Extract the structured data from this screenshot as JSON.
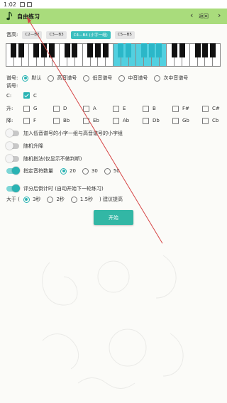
{
  "status_bar": {
    "time": "1:02"
  },
  "toolbar": {
    "title": "自由练习",
    "prev": "‹",
    "back": "返回",
    "next": "›"
  },
  "range": {
    "label": "音高:",
    "options": [
      {
        "label": "C2—B2",
        "active": false
      },
      {
        "label": "C3—B3",
        "active": false
      },
      {
        "label": "C4—B4 (小字一组)",
        "active": true
      },
      {
        "label": "C5—B5",
        "active": false
      }
    ]
  },
  "clef": {
    "label": "谱号:",
    "options": [
      {
        "label": "默认",
        "selected": true
      },
      {
        "label": "高音谱号",
        "selected": false
      },
      {
        "label": "低音谱号",
        "selected": false
      },
      {
        "label": "中音谱号",
        "selected": false
      },
      {
        "label": "次中音谱号",
        "selected": false
      }
    ]
  },
  "key": {
    "label": "调号:"
  },
  "natural": {
    "label": "C:",
    "items": [
      {
        "label": "C",
        "checked": true
      }
    ]
  },
  "sharp": {
    "label": "升:",
    "items": [
      "G",
      "D",
      "A",
      "E",
      "B",
      "F#",
      "C#"
    ]
  },
  "flat": {
    "label": "降:",
    "items": [
      "F",
      "Bb",
      "Eb",
      "Ab",
      "Db",
      "Gb",
      "Cb"
    ]
  },
  "switches": {
    "add_octaves": {
      "label": "加入低音谱号的小字一组与高音谱号的小字组",
      "on": false
    },
    "random_accidental": {
      "label": "随机升降",
      "on": false
    },
    "random_fingering": {
      "label": "随机指法(仅显示不做判断)",
      "on": false
    },
    "note_count": {
      "label": "指定音符数量",
      "on": true,
      "options": [
        "20",
        "30",
        "50"
      ],
      "selected": "20"
    },
    "countdown": {
      "label": "评分后倒计时 (自动开始下一轮练习)",
      "on": true
    }
  },
  "threshold": {
    "prefix": "大于 (",
    "options": [
      "3秒",
      "2秒",
      "1.5秒"
    ],
    "selected": "3秒",
    "suffix": ") 建议提高"
  },
  "start_button": {
    "label": "开始"
  },
  "colors": {
    "toolbar": "#a9dc7c",
    "accent": "#29b3b3",
    "highlight_keys": "#52d0e0",
    "start_button": "#32b7a5"
  }
}
